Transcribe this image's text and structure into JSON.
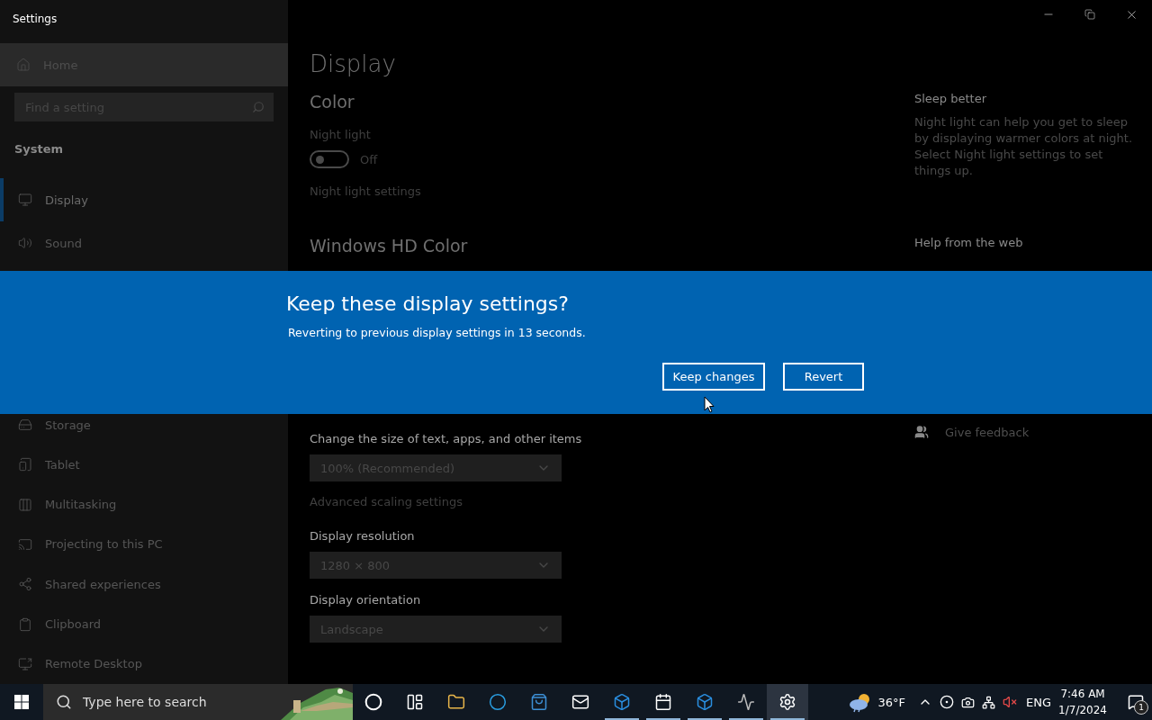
{
  "window": {
    "title": "Settings"
  },
  "sidebar": {
    "home": "Home",
    "search": {
      "placeholder": "Find a setting"
    },
    "section": "System",
    "items_top": [
      {
        "label": "Display",
        "selected": true
      },
      {
        "label": "Sound",
        "selected": false
      }
    ],
    "items_bottom": [
      {
        "label": "Storage",
        "selected": false
      },
      {
        "label": "Tablet",
        "selected": false
      },
      {
        "label": "Multitasking",
        "selected": false
      },
      {
        "label": "Projecting to this PC",
        "selected": false
      },
      {
        "label": "Shared experiences",
        "selected": false
      },
      {
        "label": "Clipboard",
        "selected": false
      },
      {
        "label": "Remote Desktop",
        "selected": false
      }
    ]
  },
  "page": {
    "title": "Display",
    "color_heading": "Color",
    "night_light": {
      "label": "Night light",
      "on": false,
      "state": "Off"
    },
    "night_light_link": "Night light settings",
    "hd_color_heading": "Windows HD Color",
    "scale": {
      "label": "Change the size of text, apps, and other items",
      "value": "100% (Recommended)"
    },
    "advanced_link": "Advanced scaling settings",
    "resolution": {
      "label": "Display resolution",
      "value": "1280 × 800"
    },
    "orientation": {
      "label": "Display orientation",
      "value": "Landscape"
    }
  },
  "aside": {
    "sleep_heading": "Sleep better",
    "sleep_text": "Night light can help you get to sleep by displaying warmer colors at night. Select Night light settings to set things up.",
    "help_heading": "Help from the web",
    "feedback": "Give feedback"
  },
  "dialog": {
    "title": "Keep these display settings?",
    "message": "Reverting to previous display settings in 13 seconds.",
    "buttons": [
      "Keep changes",
      "Revert"
    ]
  },
  "taskbar": {
    "search": {
      "placeholder": "Type here to search"
    },
    "apps": [
      {
        "running": false,
        "selected": false
      },
      {
        "running": false,
        "selected": false
      },
      {
        "running": false,
        "selected": false
      },
      {
        "running": false,
        "selected": false
      },
      {
        "running": false,
        "selected": false
      },
      {
        "running": false,
        "selected": false
      },
      {
        "running": true,
        "selected": false
      },
      {
        "running": true,
        "selected": false
      },
      {
        "running": true,
        "selected": false
      },
      {
        "running": true,
        "selected": false
      },
      {
        "running": true,
        "selected": true
      }
    ],
    "temperature": "36°F",
    "language": "ENG",
    "time": "7:46 AM",
    "date": "1/7/2024",
    "notifications": "1"
  }
}
